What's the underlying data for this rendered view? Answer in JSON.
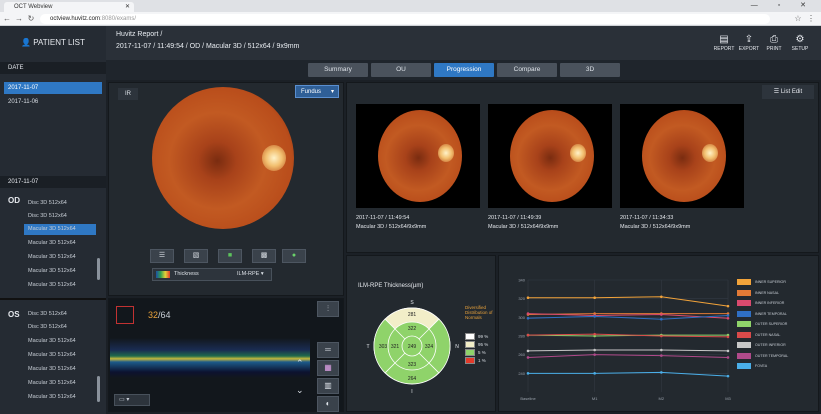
{
  "browser": {
    "tab_title": "OCT Webview",
    "url_host": "octview.huvitz.com",
    "url_path": ":8080/exams/",
    "window_controls": "— ▫ ✕"
  },
  "sidebar": {
    "patient_list": "PATIENT LIST",
    "date_header": "DATE",
    "dates": [
      "2017-11-07",
      "2017-11-06"
    ],
    "selected_date_header": "2017-11-07",
    "od": {
      "label": "OD",
      "scans": [
        "Disc 3D 512x64",
        "Disc 3D 512x64",
        "Macular 3D 512x64",
        "Macular 3D 512x64",
        "Macular 3D 512x64",
        "Macular 3D 512x64",
        "Macular 3D 512x64"
      ]
    },
    "os": {
      "label": "OS",
      "scans": [
        "Disc 3D 512x64",
        "Disc 3D 512x64",
        "Macular 3D 512x64",
        "Macular 3D 512x64",
        "Macular 3D 512x64",
        "Macular 3D 512x64",
        "Macular 3D 512x64"
      ]
    }
  },
  "header": {
    "title": "Huvitz Report /",
    "subtitle": "2017-11-07 / 11:49:54 / OD / Macular 3D / 512x64 / 9x9mm",
    "tools": [
      {
        "label": "REPORT",
        "icon": "report-icon"
      },
      {
        "label": "EXPORT",
        "icon": "export-icon"
      },
      {
        "label": "PRINT",
        "icon": "print-icon"
      },
      {
        "label": "SETUP",
        "icon": "gear-icon"
      }
    ]
  },
  "tabs": [
    "Summary",
    "OU",
    "Progression",
    "Compare",
    "3D"
  ],
  "active_tab": "Progression",
  "ir_panel": {
    "label": "IR",
    "fundus_select": "Fundus",
    "thickness_label": "Thickness",
    "thickness_value": "ILM-RPE"
  },
  "bscan": {
    "frame": "32",
    "total": "/64"
  },
  "thumbs": {
    "list_edit": "List Edit",
    "items": [
      {
        "line1": "2017-11-07 / 11:49:54",
        "line2": "Macular 3D / 512x64/9x9mm"
      },
      {
        "line1": "2017-11-07 / 11:49:39",
        "line2": "Macular 3D / 512x64/9x9mm"
      },
      {
        "line1": "2017-11-07 / 11:34:33",
        "line2": "Macular 3D / 512x64/9x9mm"
      }
    ]
  },
  "etdrs": {
    "title": "ILM-RPE Thickness(µm)",
    "labels": {
      "S": "S",
      "I": "I",
      "T": "T",
      "N": "N"
    },
    "values": {
      "outer_s": "281",
      "inner_s": "322",
      "outer_t": "303",
      "inner_t": "321",
      "center": "249",
      "inner_n": "324",
      "outer_n": "",
      "inner_i": "323",
      "outer_i": "264"
    },
    "legend_title": "Diversified Distribution of Normals",
    "legend": [
      {
        "label": "99 %",
        "color": "#ffffff"
      },
      {
        "label": "95 %",
        "color": "#f2eec8"
      },
      {
        "label": "5 %",
        "color": "#8fd36a"
      },
      {
        "label": "1 %",
        "color": "#e33a2a"
      }
    ]
  },
  "chart_data": {
    "type": "line",
    "categories": [
      "Baseline",
      "M1",
      "M2",
      "M3"
    ],
    "ylim": [
      220,
      340
    ],
    "yticks": [
      240,
      260,
      280,
      300,
      320,
      340
    ],
    "series": [
      {
        "name": "INNER SUPERIOR",
        "color": "#f2a33a",
        "values": [
          321,
          321,
          322,
          312
        ]
      },
      {
        "name": "INNER NASAL",
        "color": "#e27a36",
        "values": [
          303,
          304,
          304,
          304
        ]
      },
      {
        "name": "INNER INFERIOR",
        "color": "#d94a6e",
        "values": [
          304,
          302,
          303,
          299
        ]
      },
      {
        "name": "INNER TEMPORAL",
        "color": "#2f6fc4",
        "values": [
          299,
          301,
          298,
          302
        ]
      },
      {
        "name": "OUTER SUPERIOR",
        "color": "#8fd36a",
        "values": [
          281,
          280,
          281,
          281
        ]
      },
      {
        "name": "OUTER NASAL",
        "color": "#d94a4a",
        "values": [
          281,
          282,
          280,
          279
        ]
      },
      {
        "name": "OUTER INFERIOR",
        "color": "#c8c8c8",
        "values": [
          264,
          265,
          265,
          264
        ]
      },
      {
        "name": "OUTER TEMPORAL",
        "color": "#b04a8a",
        "values": [
          257,
          260,
          259,
          257
        ]
      },
      {
        "name": "FOVEA",
        "color": "#4aaee8",
        "values": [
          240,
          240,
          241,
          237
        ]
      }
    ]
  }
}
